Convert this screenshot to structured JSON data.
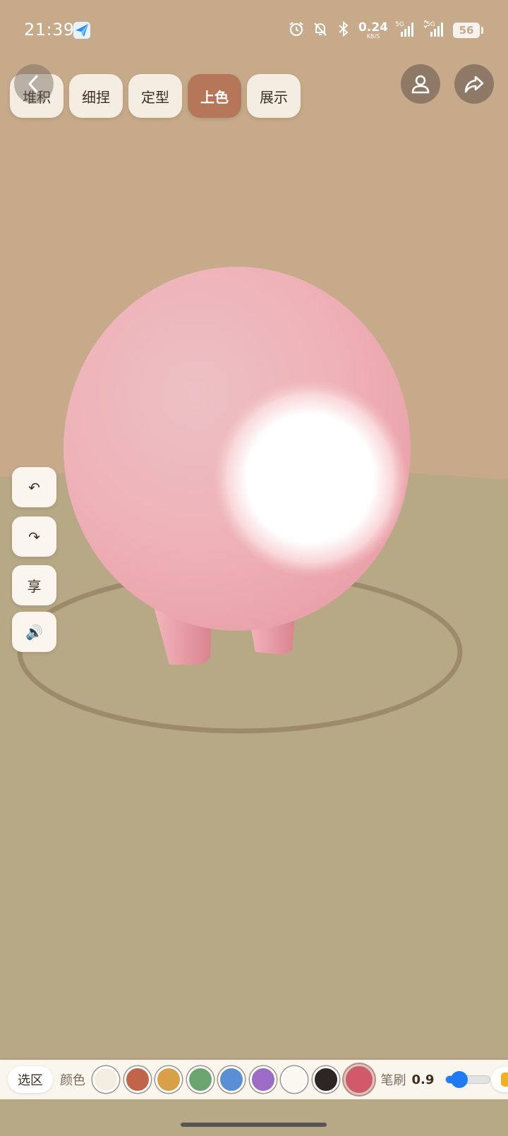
{
  "status_bar": {
    "time": "21:39",
    "net_speed_value": "0.24",
    "net_speed_unit": "KB/S",
    "signal_1_label": "5G",
    "signal_2_label": "5G",
    "battery": "56",
    "icons": [
      "alarm-icon",
      "bell-off-icon",
      "bluetooth-icon",
      "signal-icon",
      "signal-icon",
      "battery-icon"
    ]
  },
  "tabs": [
    {
      "label": "堆积",
      "active": false
    },
    {
      "label": "细捏",
      "active": false
    },
    {
      "label": "定型",
      "active": false
    },
    {
      "label": "上色",
      "active": true
    },
    {
      "label": "展示",
      "active": false
    }
  ],
  "top_actions": {
    "back_icon": "chevron-left-icon",
    "profile_icon": "user-icon",
    "share_icon": "share-icon"
  },
  "side_tools": {
    "undo_symbol": "↶",
    "redo_symbol": "↷",
    "share_label": "享",
    "sound_symbol": "🔊"
  },
  "toolbar": {
    "select_label": "选区",
    "color_label": "颜色",
    "swatches": [
      "#f5ede2",
      "#c0654a",
      "#d9a04a",
      "#6aa56f",
      "#5b8fd4",
      "#9c6cc7",
      "#fbf8f1",
      "#2e2624",
      "#d05a6a"
    ],
    "selected_color": "#d05a6a",
    "brush_label": "笔刷",
    "brush_value": "0.9",
    "brush_level": 0.3
  },
  "colors": {
    "sky": "#c6aa89",
    "floor": "#b7a886",
    "accent": "#b5765a",
    "figure": "#f0b4b8",
    "slider": "#1f7bf2"
  }
}
